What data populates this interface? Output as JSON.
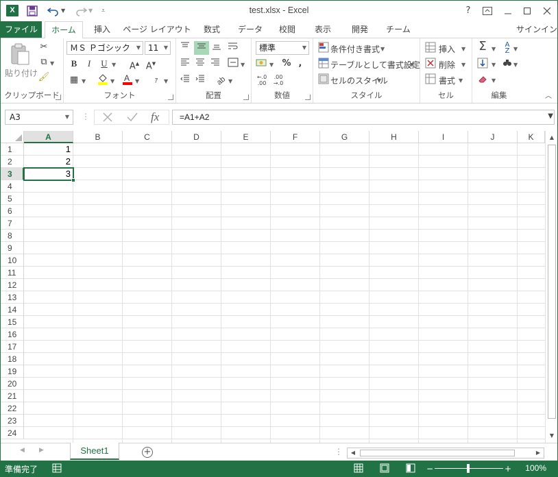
{
  "titlebar": {
    "title": "test.xlsx - Excel",
    "app_icon": "excel-logo",
    "help": "?"
  },
  "ribbon_tabs": [
    {
      "label": "ファイル"
    },
    {
      "label": "ホーム"
    },
    {
      "label": "挿入"
    },
    {
      "label": "ページ レイアウト"
    },
    {
      "label": "数式"
    },
    {
      "label": "データ"
    },
    {
      "label": "校閲"
    },
    {
      "label": "表示"
    },
    {
      "label": "開発"
    },
    {
      "label": "チーム"
    }
  ],
  "signin": "サインイン",
  "ribbon": {
    "clipboard": {
      "paste": "貼り付け",
      "label": "クリップボード"
    },
    "font": {
      "name": "ＭＳ Ｐゴシック",
      "size": "11",
      "bold": "B",
      "italic": "I",
      "underline": "U",
      "label": "フォント"
    },
    "alignment": {
      "label": "配置"
    },
    "number": {
      "format": "標準",
      "label": "数値"
    },
    "styles": {
      "conditional": "条件付き書式",
      "table": "テーブルとして書式設定",
      "cell_styles": "セルのスタイル",
      "label": "スタイル"
    },
    "cells": {
      "insert": "挿入",
      "delete": "削除",
      "format": "書式",
      "label": "セル"
    },
    "editing": {
      "label": "編集"
    }
  },
  "formula_bar": {
    "name_box": "A3",
    "fx": "fx",
    "formula": "=A1+A2"
  },
  "grid": {
    "columns": [
      "A",
      "B",
      "C",
      "D",
      "E",
      "F",
      "G",
      "H",
      "I",
      "J",
      "K"
    ],
    "rows": [
      "1",
      "2",
      "3",
      "4",
      "5",
      "6",
      "7",
      "8",
      "9",
      "10",
      "11",
      "12",
      "13",
      "14",
      "15",
      "16",
      "17",
      "18",
      "19",
      "20",
      "21",
      "22",
      "23",
      "24"
    ],
    "selected_cell": "A3",
    "cells": [
      {
        "ref": "A1",
        "value": "1"
      },
      {
        "ref": "A2",
        "value": "2"
      },
      {
        "ref": "A3",
        "value": "3"
      }
    ]
  },
  "sheets": {
    "tabs": [
      {
        "label": "Sheet1"
      }
    ],
    "add": "+"
  },
  "status": {
    "ready": "準備完了",
    "zoom": "100%",
    "accent": "#217346"
  }
}
